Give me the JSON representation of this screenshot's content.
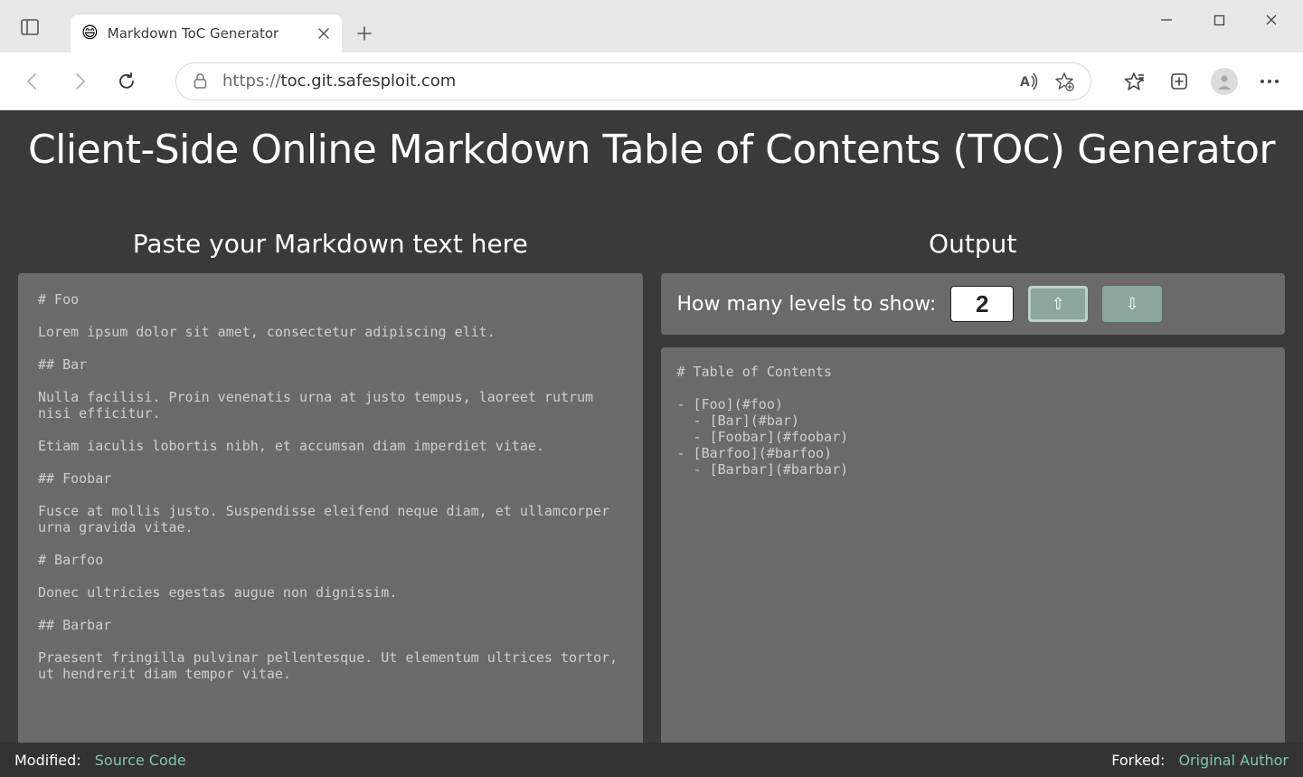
{
  "browser": {
    "tab": {
      "favicon": "😄",
      "title": "Markdown ToC Generator"
    },
    "url_display": "https://toc.git.safesploit.com",
    "url_scheme": "https://",
    "url_rest": "toc.git.safesploit.com"
  },
  "page": {
    "title": "Client-Side Online Markdown Table of Contents (TOC) Generator",
    "input_heading": "Paste your Markdown text here",
    "output_heading": "Output",
    "controls": {
      "label": "How many levels to show:",
      "value": "2"
    },
    "input_text": "# Foo\n\nLorem ipsum dolor sit amet, consectetur adipiscing elit.\n\n## Bar\n\nNulla facilisi. Proin venenatis urna at justo tempus, laoreet rutrum nisi efficitur.\n\nEtiam iaculis lobortis nibh, et accumsan diam imperdiet vitae.\n\n## Foobar\n\nFusce at mollis justo. Suspendisse eleifend neque diam, et ullamcorper urna gravida vitae.\n\n# Barfoo\n\nDonec ultricies egestas augue non dignissim.\n\n## Barbar\n\nPraesent fringilla pulvinar pellentesque. Ut elementum ultrices tortor, ut hendrerit diam tempor vitae.",
    "output_text": "# Table of Contents\n\n- [Foo](#foo)\n  - [Bar](#bar)\n  - [Foobar](#foobar)\n- [Barfoo](#barfoo)\n  - [Barbar](#barbar)",
    "footer": {
      "modified_label": "Modified:",
      "source_link": "Source Code",
      "forked_label": "Forked:",
      "author_link": "Original Author"
    }
  }
}
